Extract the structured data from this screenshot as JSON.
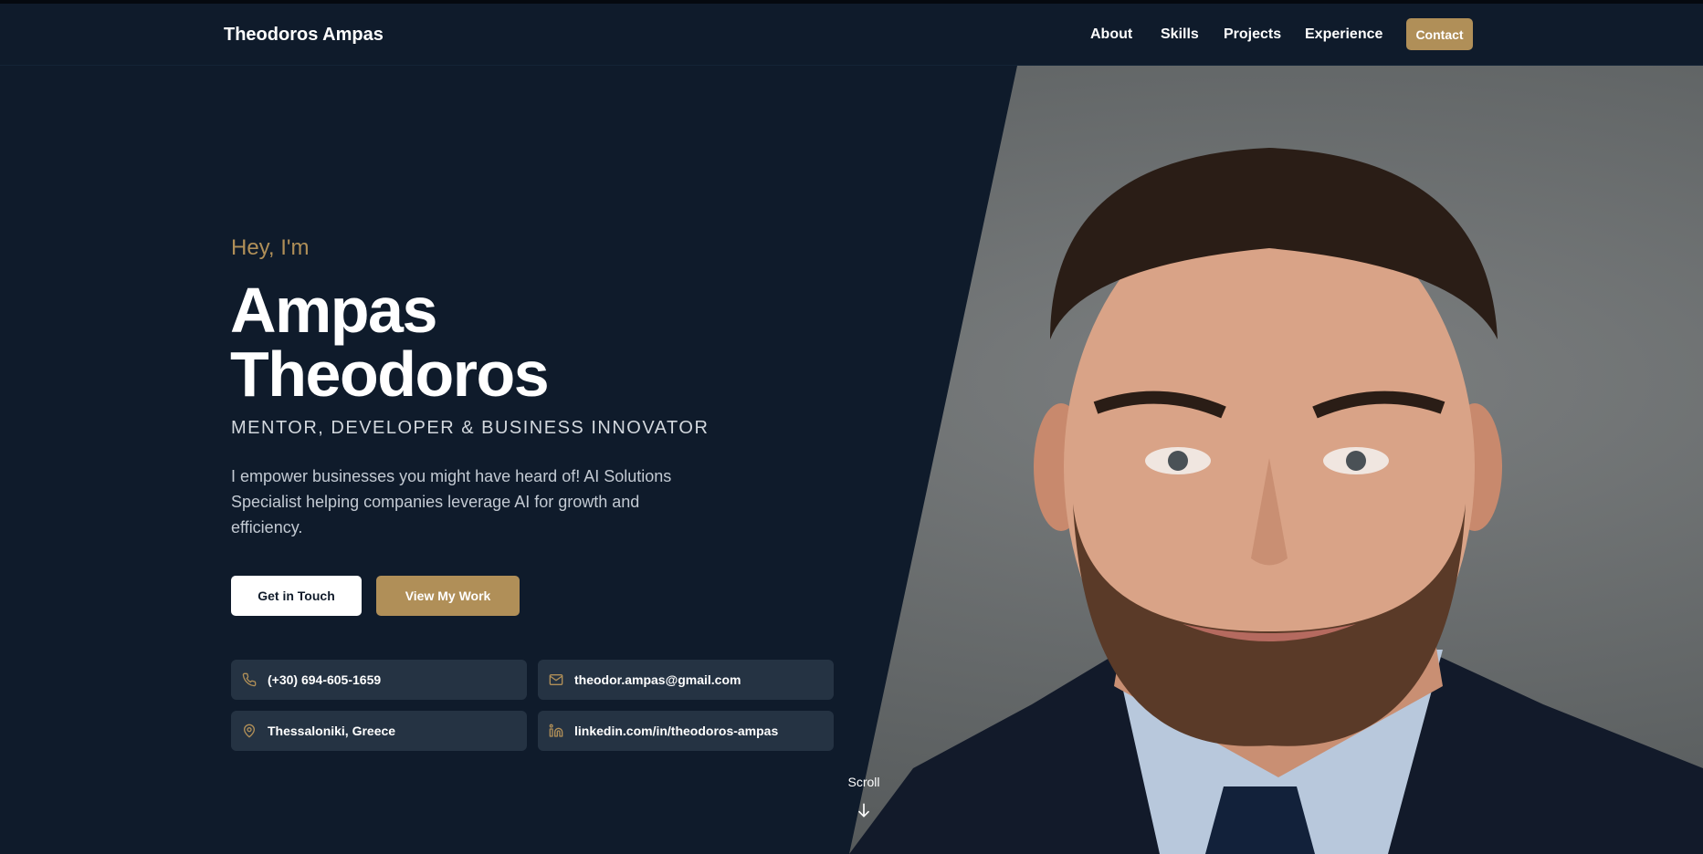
{
  "nav": {
    "brand": "Theodoros Ampas",
    "links": [
      "About",
      "Skills",
      "Projects",
      "Experience"
    ],
    "contact": "Contact"
  },
  "hero": {
    "greeting": "Hey, I'm",
    "name_line1": "Ampas",
    "name_line2": "Theodoros",
    "role": "MENTOR, DEVELOPER & BUSINESS INNOVATOR",
    "description": "I empower businesses you might have heard of! AI Solutions Specialist helping companies leverage AI for growth and efficiency.",
    "cta_primary": "Get in Touch",
    "cta_secondary": "View My Work"
  },
  "contact_cards": {
    "phone": "(+30) 694-605-1659",
    "email": "theodor.ampas@gmail.com",
    "location": "Thessaloniki, Greece",
    "linkedin": "linkedin.com/in/theodoros-ampas"
  },
  "scroll": "Scroll",
  "colors": {
    "background": "#0f1b2b",
    "accent": "#b08f58",
    "card": "#253343"
  },
  "icons": [
    "phone-icon",
    "mail-icon",
    "map-pin-icon",
    "linkedin-icon",
    "arrow-down-icon"
  ]
}
